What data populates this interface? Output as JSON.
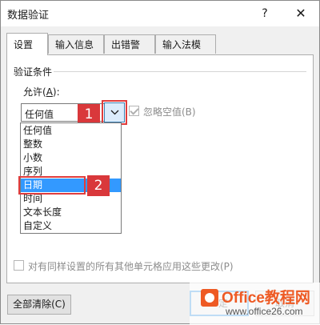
{
  "window": {
    "title": "数据验证",
    "help_label": "?",
    "close_label": "✕"
  },
  "tabs": [
    {
      "label": "设置",
      "active": true
    },
    {
      "label": "输入信息",
      "active": false
    },
    {
      "label": "出错警告",
      "active": false
    },
    {
      "label": "输入法模式",
      "active": false
    }
  ],
  "settings": {
    "group_label": "验证条件",
    "allow_label_prefix": "允许(",
    "allow_label_key": "A",
    "allow_label_suffix": "):",
    "allow_value": "任何值",
    "ignore_blank_label": "忽略空值(B)",
    "ignore_blank_checked": true,
    "dropdown_options": [
      "任何值",
      "整数",
      "小数",
      "序列",
      "日期",
      "时间",
      "文本长度",
      "自定义"
    ],
    "selected_option": "日期",
    "apply_all_label": "对有同样设置的所有其他单元格应用这些更改(P)",
    "apply_all_checked": false
  },
  "annotations": {
    "badge_1": "1",
    "badge_2": "2",
    "color": "#d9383b"
  },
  "buttons": {
    "clear_all": "全部清除(C)",
    "ok_partial": "定",
    "cancel_partial": "取消"
  },
  "watermark": {
    "text": "Office教程网",
    "url": "www.office26.com"
  },
  "colors": {
    "selection": "#3399ff",
    "accent": "#0078d7",
    "highlight": "#e03c3c"
  }
}
